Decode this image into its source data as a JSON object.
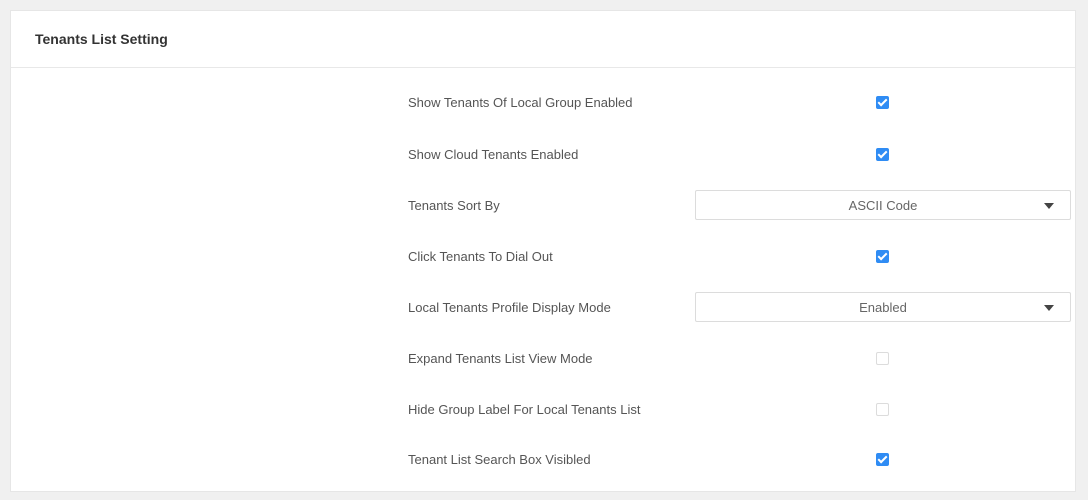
{
  "panel": {
    "title": "Tenants List Setting"
  },
  "settings": {
    "show_local_group": {
      "label": "Show Tenants Of Local Group Enabled",
      "checked": true
    },
    "show_cloud": {
      "label": "Show Cloud Tenants Enabled",
      "checked": true
    },
    "sort_by": {
      "label": "Tenants Sort By",
      "value": "ASCII Code"
    },
    "click_dial_out": {
      "label": "Click Tenants To Dial Out",
      "checked": true
    },
    "profile_display_mode": {
      "label": "Local Tenants Profile Display Mode",
      "value": "Enabled"
    },
    "expand_view_mode": {
      "label": "Expand Tenants List View Mode",
      "checked": false
    },
    "hide_group_label": {
      "label": "Hide Group Label For Local Tenants List",
      "checked": false
    },
    "search_box_visible": {
      "label": "Tenant List Search Box Visibled",
      "checked": true
    }
  },
  "colors": {
    "accent": "#2f8cf4",
    "background": "#f0f0f0",
    "panel": "#ffffff"
  },
  "icons": {
    "dropdown": "caret-down-icon",
    "checkbox": "checkmark-icon"
  }
}
